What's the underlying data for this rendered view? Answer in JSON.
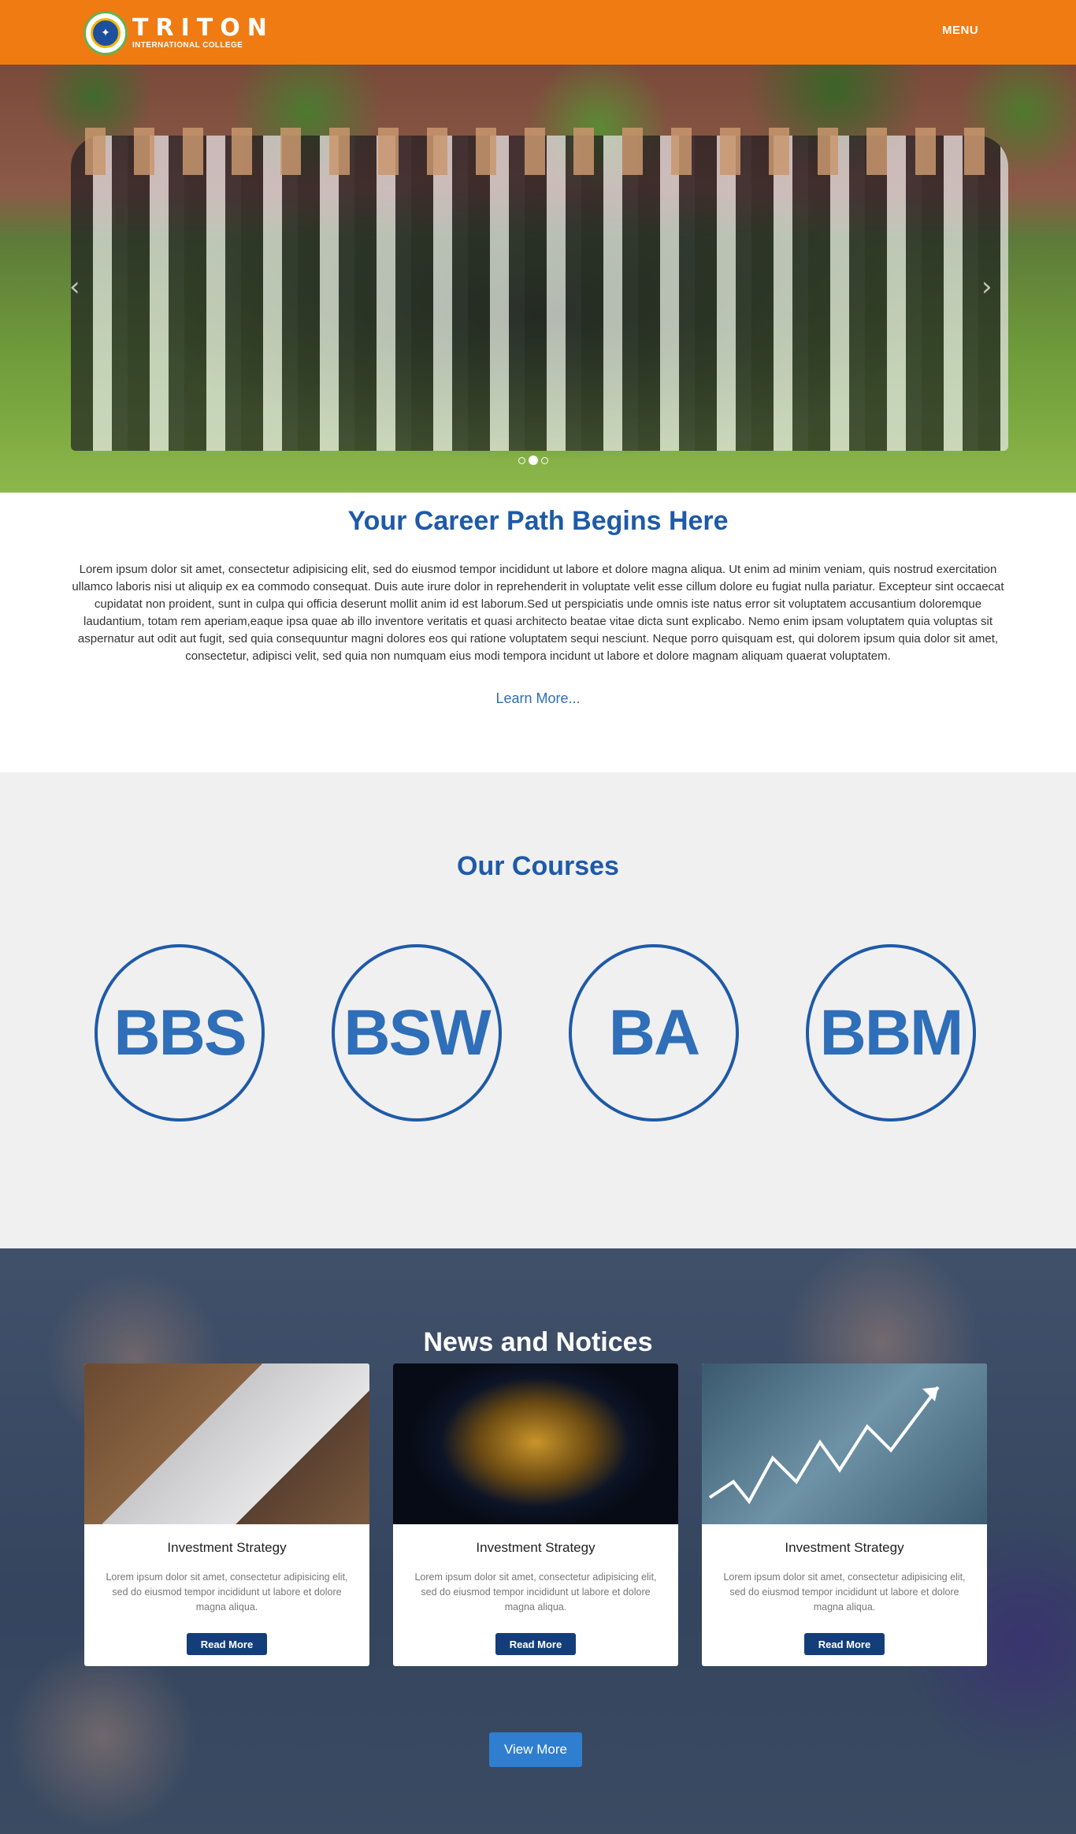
{
  "header": {
    "logo_title": "TRITON",
    "logo_subtitle": "INTERNATIONAL COLLEGE",
    "menu_label": "MENU"
  },
  "hero": {
    "prev_icon": "chevron-left-icon",
    "next_icon": "chevron-right-icon",
    "slides": 3,
    "active_slide": 2
  },
  "intro": {
    "title": "Your Career Path Begins Here",
    "text": "Lorem ipsum dolor sit amet, consectetur adipisicing elit, sed do eiusmod tempor incididunt ut labore et dolore magna aliqua. Ut enim ad minim veniam, quis nostrud exercitation ullamco laboris nisi ut aliquip ex ea commodo consequat. Duis aute irure dolor in reprehenderit in voluptate velit esse cillum dolore eu fugiat nulla pariatur. Excepteur sint occaecat cupidatat non proident, sunt in culpa qui officia deserunt mollit anim id est laborum.Sed ut perspiciatis unde omnis iste natus error sit voluptatem accusantium doloremque laudantium, totam rem aperiam,eaque ipsa quae ab illo inventore veritatis et quasi architecto beatae vitae dicta sunt explicabo. Nemo enim ipsam voluptatem quia voluptas sit aspernatur aut odit aut fugit, sed quia consequuntur magni dolores eos qui ratione voluptatem sequi nesciunt. Neque porro quisquam est, qui dolorem ipsum quia dolor sit amet, consectetur, adipisci velit, sed quia non numquam eius modi tempora incidunt ut labore et dolore magnam aliquam quaerat voluptatem.",
    "learn_more": "Learn More..."
  },
  "courses": {
    "title": "Our Courses",
    "items": [
      "BBS",
      "BSW",
      "BA",
      "BBM"
    ]
  },
  "news": {
    "title": "News and Notices",
    "cards": [
      {
        "title": "Investment Strategy",
        "text": "Lorem ipsum dolor sit amet, consectetur adipisicing elit, sed do eiusmod tempor incididunt ut labore et dolore magna aliqua.",
        "button": "Read More"
      },
      {
        "title": "Investment Strategy",
        "text": "Lorem ipsum dolor sit amet, consectetur adipisicing elit, sed do eiusmod tempor incididunt ut labore et dolore magna aliqua.",
        "button": "Read More"
      },
      {
        "title": "Investment Strategy",
        "text": "Lorem ipsum dolor sit amet, consectetur adipisicing elit, sed do eiusmod tempor incididunt ut labore et dolore magna aliqua.",
        "button": "Read More"
      }
    ],
    "view_more": "View More"
  },
  "colors": {
    "header_bg": "#f07b12",
    "heading_blue": "#1e5aa8",
    "button_navy": "#143e7a",
    "view_more_blue": "#2f7ed0",
    "courses_bg": "#f0f0f0"
  }
}
